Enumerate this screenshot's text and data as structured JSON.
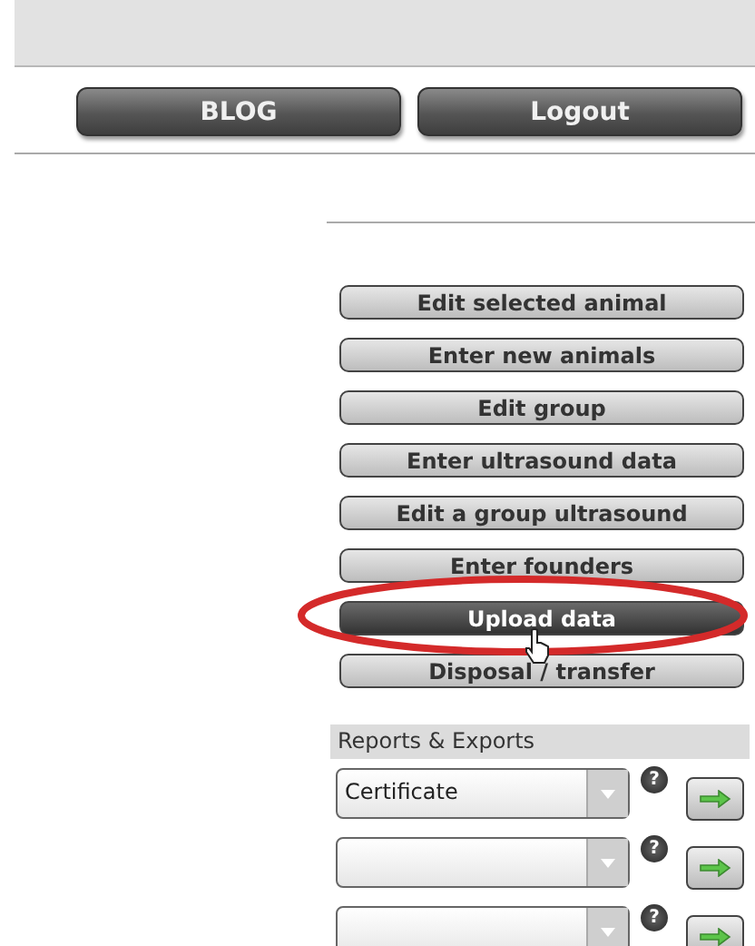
{
  "header_buttons": [
    {
      "label": "BLOG"
    },
    {
      "label": "Logout"
    }
  ],
  "menu": [
    {
      "label": "Edit selected animal",
      "selected": false
    },
    {
      "label": "Enter new animals",
      "selected": false
    },
    {
      "label": "Edit group",
      "selected": false
    },
    {
      "label": "Enter ultrasound data",
      "selected": false
    },
    {
      "label": "Edit a group ultrasound",
      "selected": false
    },
    {
      "label": "Enter founders",
      "selected": false
    },
    {
      "label": "Upload data",
      "selected": true
    },
    {
      "label": "Disposal / transfer",
      "selected": false
    }
  ],
  "reports": {
    "title": "Reports & Exports",
    "rows": [
      {
        "value": "Certificate",
        "help": "?"
      },
      {
        "help": "?"
      },
      {
        "help": "?"
      }
    ]
  }
}
